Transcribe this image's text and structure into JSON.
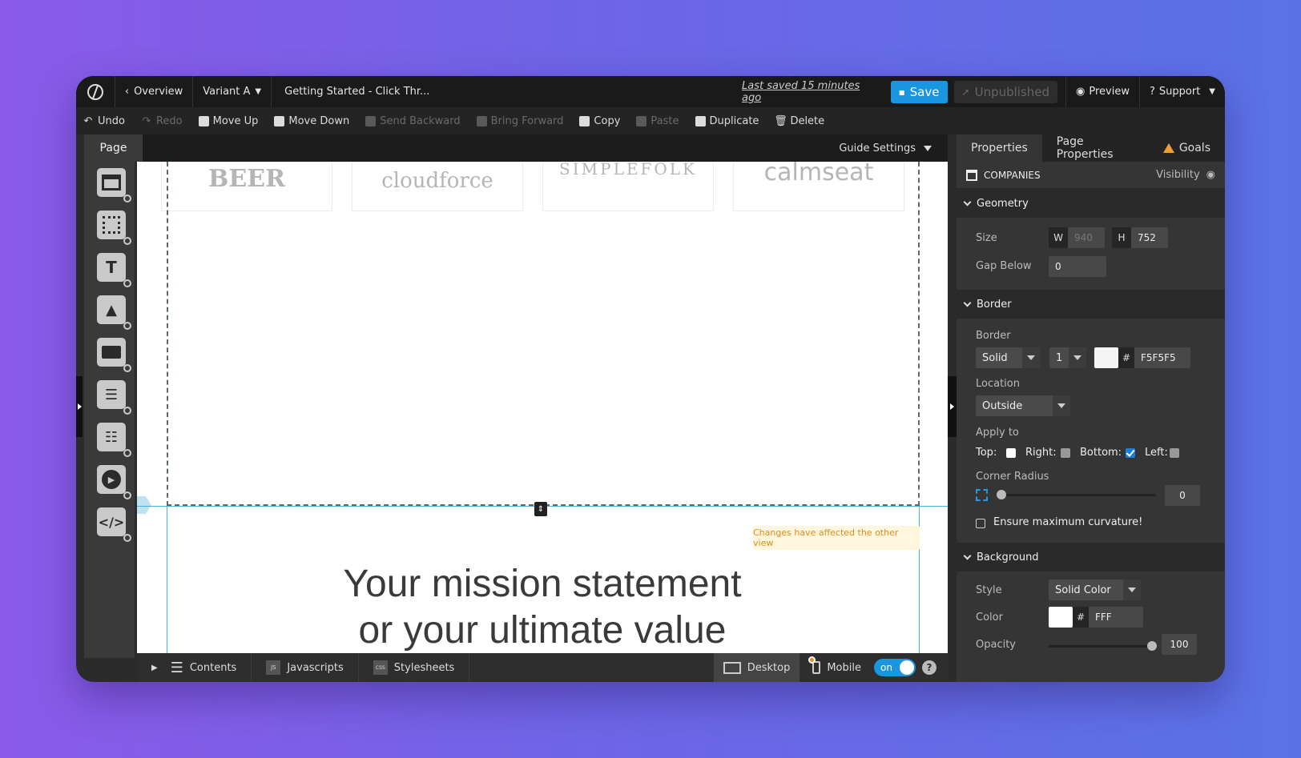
{
  "topbar": {
    "overview": "Overview",
    "variant": "Variant A",
    "page_title": "Getting Started - Click Thr...",
    "last_saved": "Last saved  15 minutes ago",
    "save": "Save",
    "unpublished": "Unpublished",
    "preview": "Preview",
    "support": "Support"
  },
  "toolbar": {
    "undo": "Undo",
    "redo": "Redo",
    "move_up": "Move Up",
    "move_down": "Move Down",
    "send_backward": "Send Backward",
    "bring_forward": "Bring Forward",
    "copy": "Copy",
    "paste": "Paste",
    "duplicate": "Duplicate",
    "delete": "Delete"
  },
  "palette": {
    "page_tab": "Page",
    "items": [
      "section-icon",
      "box-icon",
      "text-icon",
      "image-icon",
      "button-icon",
      "form-icon",
      "lightbox-icon",
      "video-icon",
      "code-icon"
    ]
  },
  "canvas_head": {
    "guide_settings": "Guide Settings"
  },
  "canvas": {
    "logos": [
      "BEER",
      "cloudforce",
      "SIMPLEFOLK",
      "calmseat"
    ],
    "headline_1": "Your mission statement",
    "headline_2": "or your ultimate value",
    "toast": "Changes have affected the other view"
  },
  "bottombar": {
    "contents": "Contents",
    "javascripts": "Javascripts",
    "js_badge": "JS",
    "stylesheets": "Stylesheets",
    "css_badge": "CSS",
    "desktop": "Desktop",
    "mobile": "Mobile",
    "toggle": "on",
    "help": "?"
  },
  "panel": {
    "tabs": [
      "Properties",
      "Page Properties",
      "Goals"
    ],
    "component": "COMPANIES",
    "visibility": "Visibility",
    "geometry": {
      "title": "Geometry",
      "size_label": "Size",
      "w_label": "W",
      "w_value": "940",
      "h_label": "H",
      "h_value": "752",
      "gap_label": "Gap Below",
      "gap_value": "0"
    },
    "border": {
      "title": "Border",
      "border_label": "Border",
      "style": "Solid",
      "width": "1",
      "hash": "#",
      "color": "F5F5F5",
      "location_label": "Location",
      "location": "Outside",
      "apply_label": "Apply to",
      "top": "Top:",
      "right": "Right:",
      "bottom": "Bottom:",
      "left": "Left:",
      "radius_label": "Corner Radius",
      "radius_value": "0",
      "curvature": "Ensure maximum curvature!"
    },
    "background": {
      "title": "Background",
      "style_label": "Style",
      "style": "Solid Color",
      "color_label": "Color",
      "hash": "#",
      "color": "FFF",
      "opacity_label": "Opacity",
      "opacity": "100"
    }
  }
}
